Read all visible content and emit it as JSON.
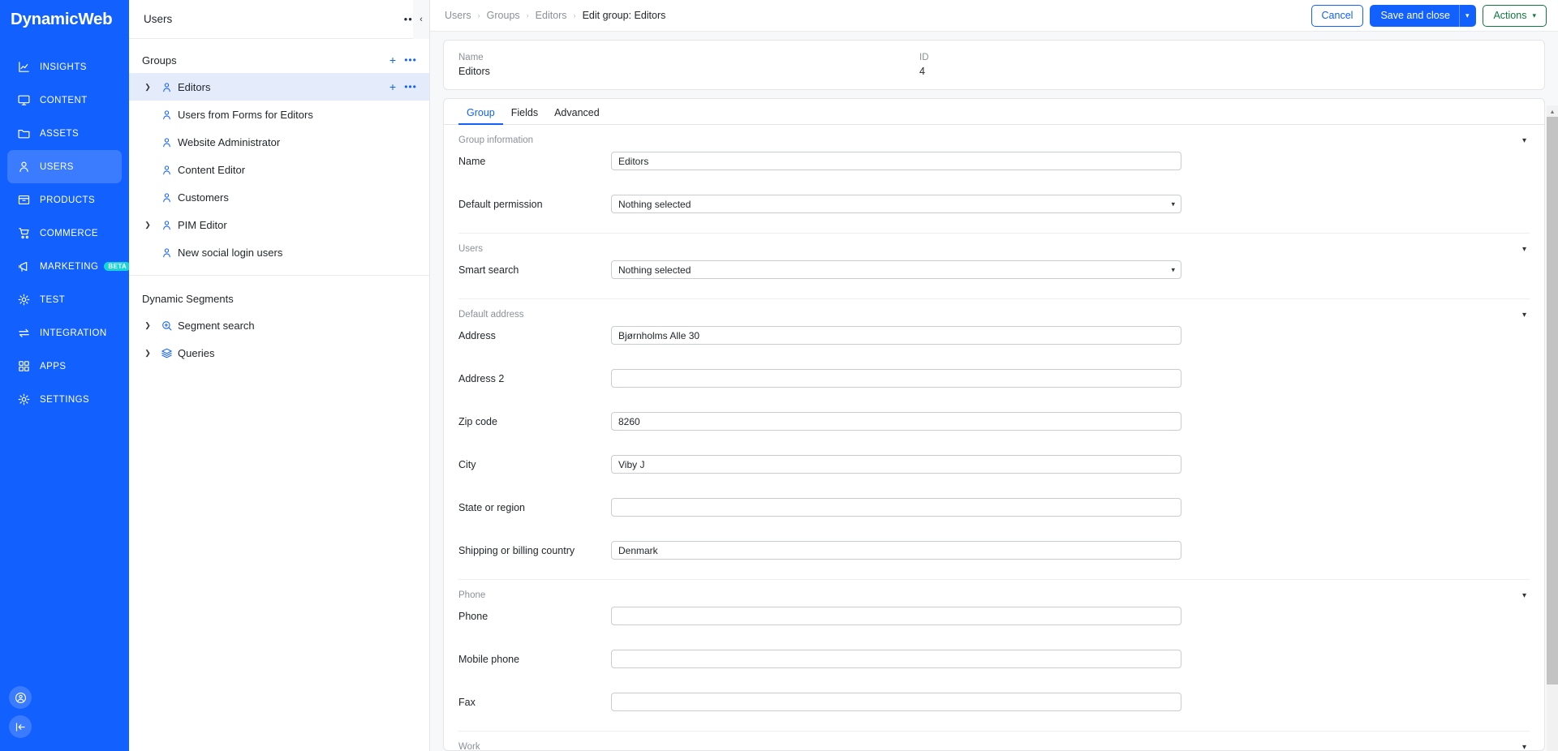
{
  "brand": {
    "name": "DynamicWeb"
  },
  "colors": {
    "rail_bg": "#1260fe",
    "rail_active": "#3b7bfe",
    "accent": "#1260fe",
    "beta_badge": "#17d6d6",
    "actions_green": "#0f7a3d",
    "tree_selected": "#e4ebfa"
  },
  "rail": {
    "items": [
      {
        "label": "INSIGHTS",
        "icon": "chart-line-icon",
        "active": false,
        "badge": ""
      },
      {
        "label": "CONTENT",
        "icon": "monitor-icon",
        "active": false,
        "badge": ""
      },
      {
        "label": "ASSETS",
        "icon": "folder-icon",
        "active": false,
        "badge": ""
      },
      {
        "label": "USERS",
        "icon": "user-icon",
        "active": true,
        "badge": ""
      },
      {
        "label": "PRODUCTS",
        "icon": "box-icon",
        "active": false,
        "badge": ""
      },
      {
        "label": "COMMERCE",
        "icon": "cart-icon",
        "active": false,
        "badge": ""
      },
      {
        "label": "MARKETING",
        "icon": "megaphone-icon",
        "active": false,
        "badge": "BETA"
      },
      {
        "label": "TEST",
        "icon": "gear-icon",
        "active": false,
        "badge": ""
      },
      {
        "label": "INTEGRATION",
        "icon": "exchange-arrows-icon",
        "active": false,
        "badge": ""
      },
      {
        "label": "APPS",
        "icon": "grid-apps-icon",
        "active": false,
        "badge": ""
      },
      {
        "label": "SETTINGS",
        "icon": "gear-icon",
        "active": false,
        "badge": ""
      }
    ],
    "bottom": [
      {
        "icon": "account-avatar-icon"
      },
      {
        "icon": "collapse-left-icon"
      }
    ]
  },
  "panel": {
    "title": "Users",
    "more_label": "•••",
    "collapse_icon": "chevron-left-icon",
    "sections": [
      {
        "name": "Groups",
        "add_label": "+",
        "more_label": "•••",
        "items": [
          {
            "label": "Editors",
            "icon": "user-group-icon",
            "expandable": true,
            "selected": true,
            "row_actions": true
          },
          {
            "label": "Users from Forms for Editors",
            "icon": "user-group-icon",
            "expandable": false,
            "selected": false,
            "row_actions": false
          },
          {
            "label": "Website Administrator",
            "icon": "user-group-icon",
            "expandable": false,
            "selected": false,
            "row_actions": false
          },
          {
            "label": "Content Editor",
            "icon": "user-group-icon",
            "expandable": false,
            "selected": false,
            "row_actions": false
          },
          {
            "label": "Customers",
            "icon": "user-group-icon",
            "expandable": false,
            "selected": false,
            "row_actions": false
          },
          {
            "label": "PIM Editor",
            "icon": "user-group-icon",
            "expandable": true,
            "selected": false,
            "row_actions": false
          },
          {
            "label": "New social login users",
            "icon": "user-group-icon",
            "expandable": false,
            "selected": false,
            "row_actions": false
          }
        ]
      },
      {
        "name": "Dynamic Segments",
        "add_label": "",
        "more_label": "",
        "items": [
          {
            "label": "Segment search",
            "icon": "search-plus-icon",
            "expandable": true,
            "selected": false,
            "row_actions": false
          },
          {
            "label": "Queries",
            "icon": "layers-icon",
            "expandable": true,
            "selected": false,
            "row_actions": false
          }
        ]
      }
    ]
  },
  "header": {
    "breadcrumbs": [
      "Users",
      "Groups",
      "Editors",
      "Edit group: Editors"
    ],
    "separator": "›",
    "buttons": {
      "cancel": "Cancel",
      "save_and_close": "Save and close",
      "save_dropdown_icon": "chevron-down-icon",
      "actions": "Actions",
      "actions_dropdown_icon": "chevron-down-icon"
    }
  },
  "summary": {
    "name_key": "Name",
    "name_value": "Editors",
    "id_key": "ID",
    "id_value": "4"
  },
  "tabs": [
    {
      "label": "Group",
      "active": true
    },
    {
      "label": "Fields",
      "active": false
    },
    {
      "label": "Advanced",
      "active": false
    }
  ],
  "form": {
    "collapse_icon": "chevron-down-icon",
    "groups": [
      {
        "title": "Group information",
        "collapsible": true,
        "fields": [
          {
            "label": "Name",
            "type": "text",
            "value": "Editors",
            "placeholder": ""
          },
          {
            "label": "Default permission",
            "type": "select",
            "value": "Nothing selected",
            "placeholder": ""
          }
        ]
      },
      {
        "title": "Users",
        "collapsible": true,
        "fields": [
          {
            "label": "Smart search",
            "type": "select",
            "value": "Nothing selected",
            "placeholder": ""
          }
        ]
      },
      {
        "title": "Default address",
        "collapsible": true,
        "fields": [
          {
            "label": "Address",
            "type": "text",
            "value": "Bjørnholms Alle 30",
            "placeholder": ""
          },
          {
            "label": "Address 2",
            "type": "text",
            "value": "",
            "placeholder": ""
          },
          {
            "label": "Zip code",
            "type": "text",
            "value": "8260",
            "placeholder": ""
          },
          {
            "label": "City",
            "type": "text",
            "value": "Viby J",
            "placeholder": ""
          },
          {
            "label": "State or region",
            "type": "text",
            "value": "",
            "placeholder": ""
          },
          {
            "label": "Shipping or billing country",
            "type": "text",
            "value": "Denmark",
            "placeholder": ""
          }
        ]
      },
      {
        "title": "Phone",
        "collapsible": true,
        "fields": [
          {
            "label": "Phone",
            "type": "text",
            "value": "",
            "placeholder": ""
          },
          {
            "label": "Mobile phone",
            "type": "text",
            "value": "",
            "placeholder": ""
          },
          {
            "label": "Fax",
            "type": "text",
            "value": "",
            "placeholder": ""
          }
        ]
      },
      {
        "title": "Work",
        "collapsible": true,
        "fields": []
      }
    ]
  },
  "scrollbar": {
    "up_arrow_icon": "chevron-up-icon"
  }
}
